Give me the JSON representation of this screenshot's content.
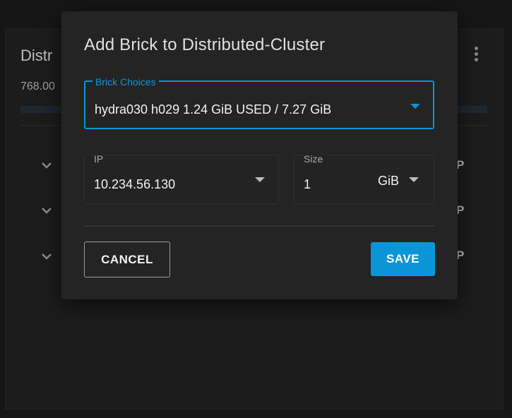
{
  "background": {
    "card_title": "Distr",
    "card_subtitle": "768.00",
    "row_suffixes": [
      "P",
      "P",
      "P"
    ],
    "icons": [
      "kebab-menu-icon",
      "chevron-down-icon"
    ]
  },
  "dialog": {
    "title": "Add Brick to Distributed-Cluster",
    "brick_choices": {
      "label": "Brick Choices",
      "value": "hydra030 h029 1.24 GiB USED / 7.27 GiB"
    },
    "ip": {
      "label": "IP",
      "value": "10.234.56.130"
    },
    "size": {
      "label": "Size",
      "value": "1",
      "unit": "GiB"
    },
    "buttons": {
      "cancel": "CANCEL",
      "save": "SAVE"
    }
  },
  "colors": {
    "accent": "#0a95d8",
    "dialog_bg": "#242424",
    "page_bg": "#161616"
  }
}
